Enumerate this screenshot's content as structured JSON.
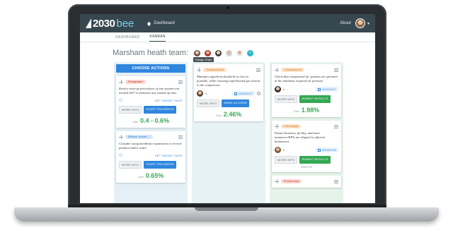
{
  "topbar": {
    "logo_number": "2030",
    "logo_suffix": "bee",
    "nav_home": "Dashboard",
    "about": "About",
    "user_caret": "▾"
  },
  "subnav": {
    "tabs": [
      "DASHBOARD",
      "KANBAN"
    ]
  },
  "team": {
    "name": "Marsham heath team:",
    "add_label": "+",
    "tooltip": "Design Team"
  },
  "columns": [
    {
      "choose_label": "CHOOSE ACTIONS",
      "cards": [
        {
          "badge": "Refrigeration",
          "text": "Review start-up procedures of any systems not needed 24/7 to minimise any wasted up time.",
          "link": "SET TARGET DATE",
          "more": "MORE INFO",
          "action": "START PROGRESS",
          "gain_label": "Gain",
          "gain": "0.4 - 0.6%"
        },
        {
          "badge": "Efficient, smooth ...",
          "text": "Consider using membrane separation to recover product and/or water.",
          "link": "SET TARGET DATE",
          "more": "MORE INFO",
          "action": "START PROGRESS",
          "gain_label": "Gain",
          "gain": "0.65%"
        }
      ]
    },
    {
      "cards": [
        {
          "badge": "Compressed air",
          "text": "Maintain superheat should be as low as possible, while ensuring superheated gas returns to the compressor.",
          "owner_caret": "▾",
          "date": "16/02/2017",
          "more": "MORE INFO",
          "action": "MARK AS DONE",
          "gain_label": "Gain",
          "gain": "2.46%"
        }
      ]
    },
    {
      "cards": [
        {
          "badge": "Compressed air",
          "text": "Check that compressed air systems are operated at the minimum required air pressure.",
          "owner_caret": "▾",
          "date": "31/01/2017",
          "more": "MORE INFO",
          "action": "SUBMIT RESULTS",
          "gain_label": "Gain",
          "gain": "1.98%"
        },
        {
          "badge": "Cold storage",
          "text": "Ensure business, facility, and team manuever/KPIs are aligned to efficient behaviours.",
          "owner_caret": "▾",
          "date": "20/02/2018",
          "more": "MORE INFO",
          "action": "SUBMIT RESULTS",
          "more_link": "More ▾ ▾"
        },
        {
          "badge": "Process heat"
        }
      ]
    }
  ],
  "colors": {
    "topbar": "#37474f",
    "primary": "#2f86de",
    "success": "#34a853",
    "gain": "#3aa857"
  }
}
